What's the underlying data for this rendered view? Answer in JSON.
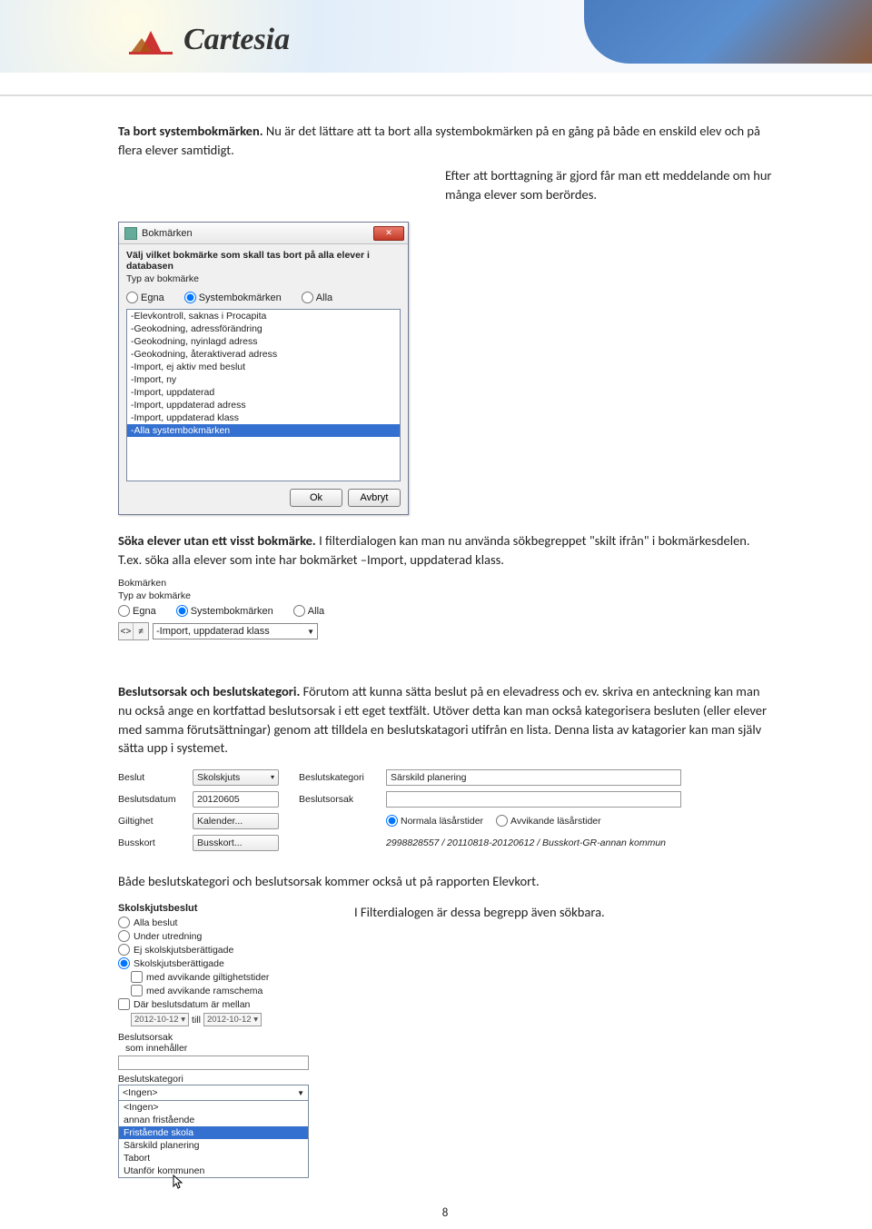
{
  "logo_text": "Cartesia",
  "doc": {
    "p1_bold": "Ta bort systembokmärken.",
    "p1_rest": " Nu är det lättare att ta bort alla systembokmärken på en gång på både en enskild elev och på flera elever samtidigt.",
    "p2": "Efter att borttagning är gjord får man ett meddelande om hur många elever som berördes.",
    "p3_bold": "Söka elever utan ett visst bokmärke.",
    "p3_rest": " I filterdialogen kan man nu använda sökbegreppet \"skilt ifrån\" i bokmärkesdelen. T.ex. söka alla elever som inte har bokmärket –Import, uppdaterad klass.",
    "p4_bold": "Beslutsorsak och beslutskategori.",
    "p4_rest": " Förutom att kunna sätta beslut på en elevadress och ev. skriva en anteckning kan man nu också ange en kortfattad beslutsorsak i ett eget textfält. Utöver detta kan man också kategorisera besluten (eller elever med samma förutsättningar) genom att tilldela en beslutskatagori utifrån en lista. Denna lista av katagorier kan man själv sätta upp i systemet.",
    "p5": "Både beslutskategori och beslutsorsak kommer också ut på rapporten Elevkort.",
    "p6": "I Filterdialogen är dessa begrepp även sökbara."
  },
  "dialog1": {
    "title": "Bokmärken",
    "header_line": "Välj vilket bokmärke som skall tas bort på alla elever i databasen",
    "type_label": "Typ av bokmärke",
    "radios": [
      "Egna",
      "Systembokmärken",
      "Alla"
    ],
    "radio_selected": 1,
    "items": [
      "-Elevkontroll, saknas i Procapita",
      "-Geokodning, adressförändring",
      "-Geokodning, nyinlagd adress",
      "-Geokodning, återaktiverad adress",
      "-Import, ej aktiv med beslut",
      "-Import, ny",
      "-Import, uppdaterad",
      "-Import, uppdaterad adress",
      "-Import, uppdaterad klass",
      "-Alla systembokmärken"
    ],
    "selected_index": 9,
    "ok": "Ok",
    "cancel": "Avbryt"
  },
  "smallfilter": {
    "title": "Bokmärken",
    "type_label": "Typ av bokmärke",
    "radios": [
      "Egna",
      "Systembokmärken",
      "Alla"
    ],
    "radio_selected": 1,
    "nav": [
      "<>",
      "≠"
    ],
    "selected": "-Import, uppdaterad klass"
  },
  "beslut": {
    "rows": [
      {
        "label": "Beslut",
        "ctrl": "Skolskjuts",
        "ctrl_drop": true,
        "label2": "Beslutskategori",
        "right_input": "Särskild planering"
      },
      {
        "label": "Beslutsdatum",
        "ctrl": "20120605",
        "ctrl_flat": true,
        "label2": "Beslutsorsak",
        "right_input": ""
      },
      {
        "label": "Giltighet",
        "ctrl": "Kalender...",
        "label2": "",
        "right_radio": {
          "options": [
            "Normala läsårstider",
            "Avvikande läsårstider"
          ],
          "selected": 0
        }
      },
      {
        "label": "Busskort",
        "ctrl": "Busskort...",
        "label2": "",
        "right_italic": "2998828557 / 20110818-20120612 / Busskort-GR-annan kommun"
      }
    ]
  },
  "filterpanel": {
    "title": "Skolskjutsbeslut",
    "radios": [
      "Alla beslut",
      "Under utredning",
      "Ej skolskjutsberättigade",
      "Skolskjutsberättigade"
    ],
    "radio_selected": 3,
    "checks": [
      "med avvikande giltighetstider",
      "med avvikande ramschema"
    ],
    "date_check": "Där beslutsdatum är mellan",
    "date1": "2012-10-12",
    "date_sep": "till",
    "date2": "2012-10-12",
    "orsak_label": "Beslutsorsak",
    "orsak_sub": "som innehåller",
    "kat_label": "Beslutskategori",
    "drop_head": "<Ingen>",
    "options": [
      "<Ingen>",
      "annan fristående",
      "Fristående skola",
      "Särskild planering",
      "Tabort",
      "Utanför kommunen"
    ],
    "selected_opt": 2
  },
  "page_number": "8"
}
